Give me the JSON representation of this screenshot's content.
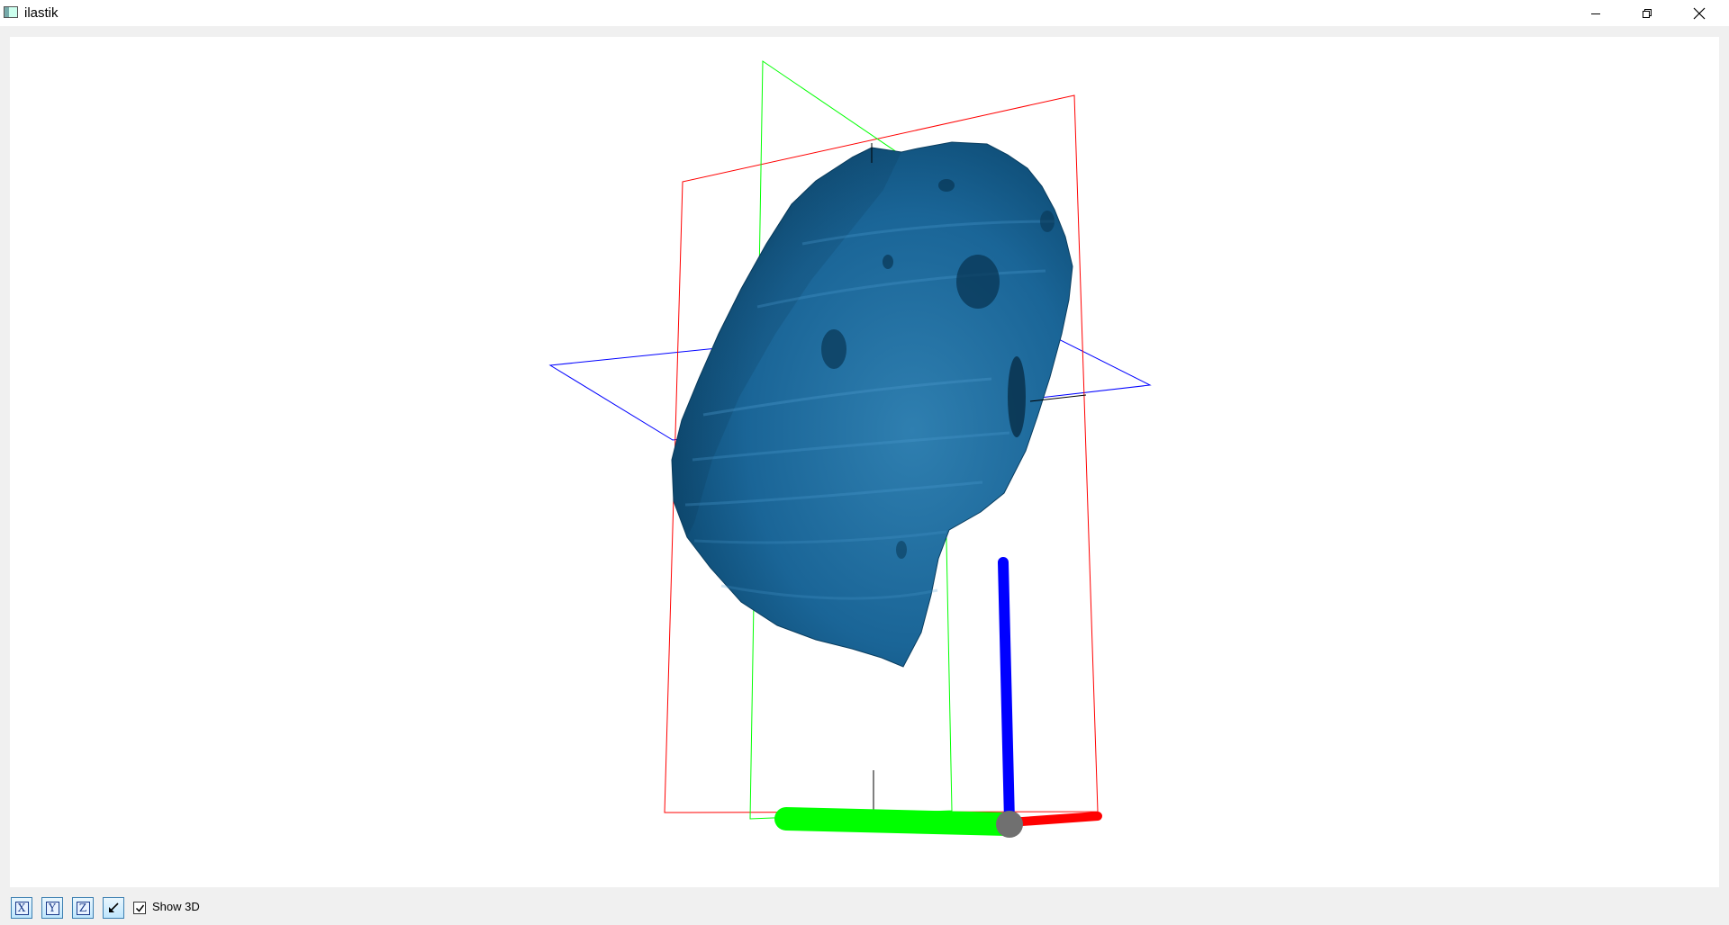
{
  "window": {
    "title": "ilastik"
  },
  "toolbar": {
    "x_button_label": "X",
    "y_button_label": "Y",
    "z_button_label": "Z",
    "show3d_label": "Show 3D",
    "show3d_checked": true
  },
  "colors": {
    "mesh": "#0e5a85",
    "x_axis": "#ff0000",
    "y_axis": "#00ff00",
    "z_axis": "#0000ff",
    "origin": "#707070"
  }
}
